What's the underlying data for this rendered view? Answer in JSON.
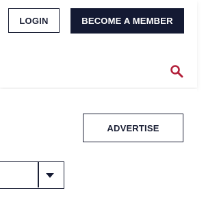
{
  "header": {
    "login_label": "LOGIN",
    "member_label": "BECOME A MEMBER",
    "search_icon": "search-icon"
  },
  "main": {
    "advertise_label": "ADVERTISE",
    "select": {
      "value": ""
    }
  },
  "colors": {
    "navy": "#141a33",
    "accent": "#b3203a"
  }
}
